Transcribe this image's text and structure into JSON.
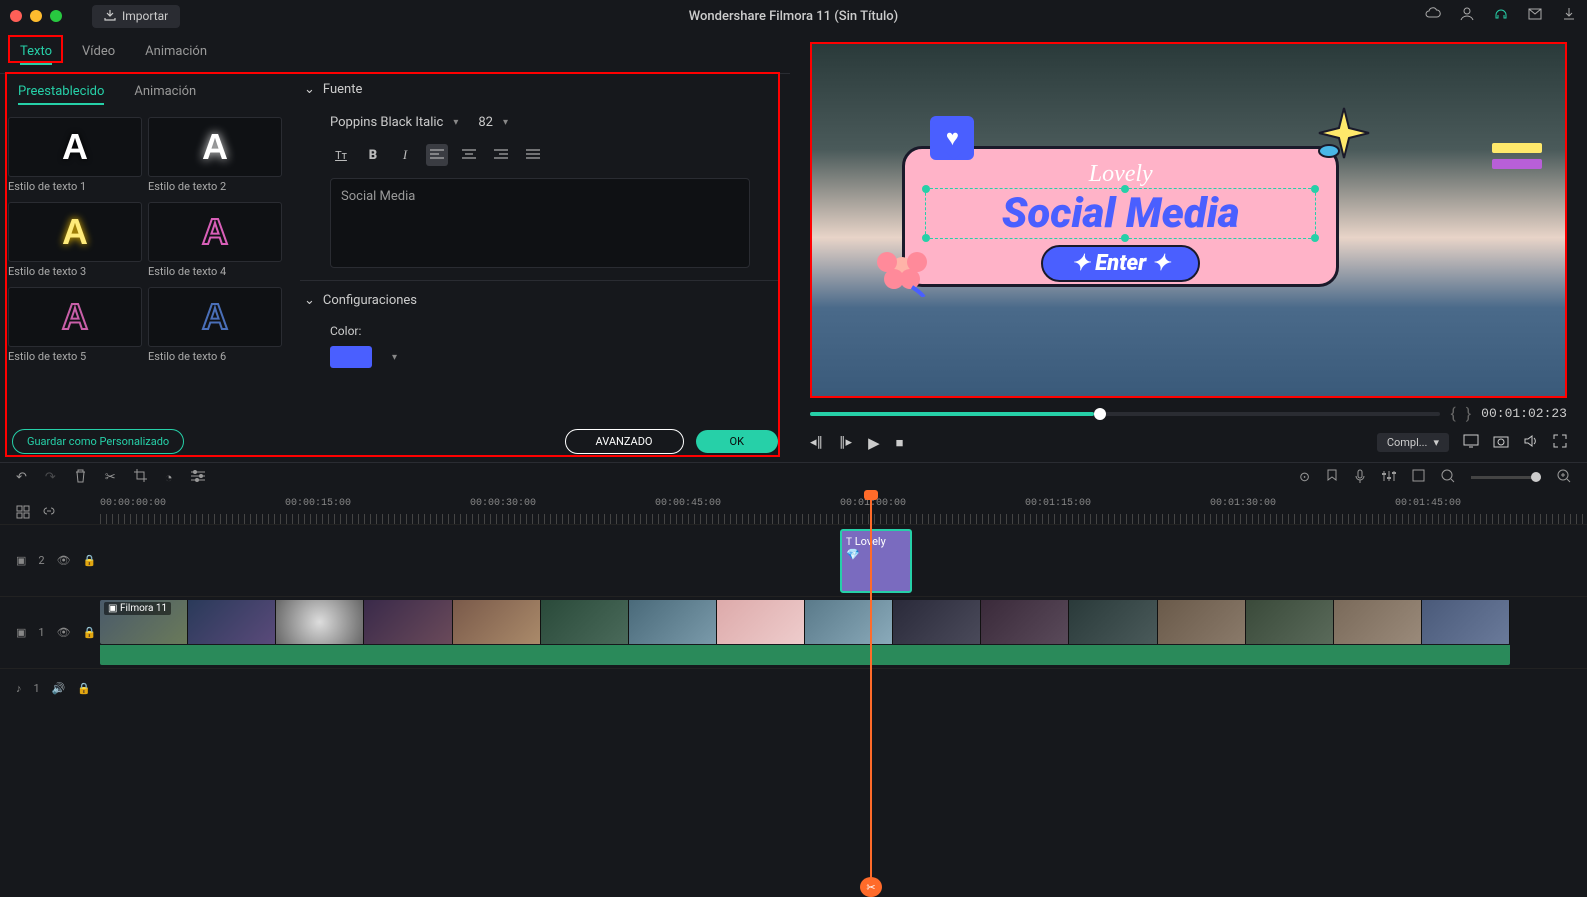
{
  "titlebar": {
    "import": "Importar",
    "title": "Wondershare Filmora 11 (Sin Título)"
  },
  "tabs": {
    "texto": "Texto",
    "video": "Vídeo",
    "anim": "Animación"
  },
  "subtabs": {
    "preset": "Preestablecido",
    "anim": "Animación"
  },
  "presets": [
    {
      "label": "Estilo de texto 1"
    },
    {
      "label": "Estilo de texto 2"
    },
    {
      "label": "Estilo de texto 3"
    },
    {
      "label": "Estilo de texto 4"
    },
    {
      "label": "Estilo de texto 5"
    },
    {
      "label": "Estilo de texto 6"
    }
  ],
  "font": {
    "section": "Fuente",
    "family": "Poppins Black Italic",
    "size": "82",
    "sample": "Social  Media"
  },
  "config": {
    "section": "Configuraciones",
    "color_label": "Color:",
    "color": "#4a5fff"
  },
  "buttons": {
    "save": "Guardar como Personalizado",
    "advanced": "AVANZADO",
    "ok": "OK"
  },
  "preview": {
    "lovely": "Lovely",
    "social": "Social Media",
    "enter": "Enter",
    "timecode": "00:01:02:23",
    "quality": "Compl..."
  },
  "timeline": {
    "marks": [
      "00:00:00:00",
      "00:00:15:00",
      "00:00:30:00",
      "00:00:45:00",
      "00:01:00:00",
      "00:01:15:00",
      "00:01:30:00",
      "00:01:45:00"
    ],
    "title_clip": "Lovely",
    "video_clip": "Filmora 11",
    "track_video2": "2",
    "track_video1": "1",
    "track_audio1": "1"
  }
}
